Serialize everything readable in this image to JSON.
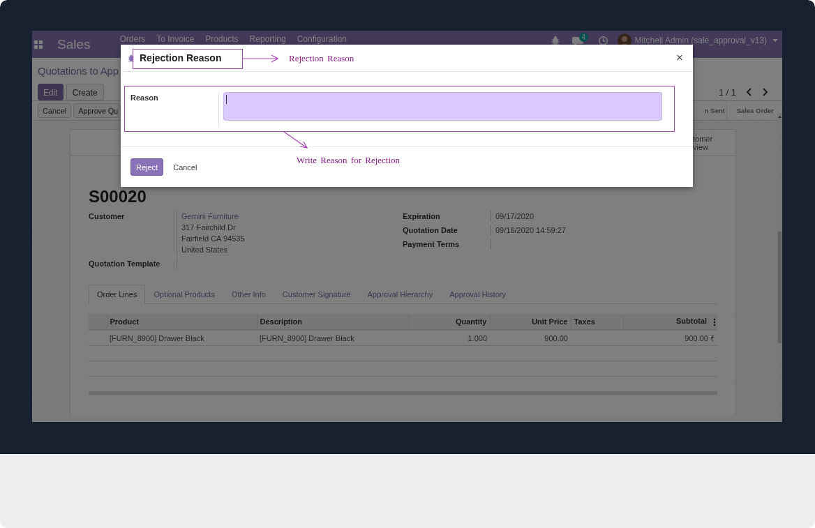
{
  "navbar": {
    "app_name": "Sales",
    "menu": [
      "Orders",
      "To Invoice",
      "Products",
      "Reporting",
      "Configuration"
    ],
    "message_count": "4",
    "user": "Mitchell Admin (sale_approval_v13)"
  },
  "breadcrumb": "Quotations to App",
  "actions": [
    "Edit",
    "Create"
  ],
  "pager": "1 / 1",
  "header_buttons": [
    "Cancel",
    "Approve Qu"
  ],
  "stages": [
    "n Sent",
    "Sales Order"
  ],
  "smart_button": {
    "lines": [
      "tomer",
      "view"
    ]
  },
  "record": {
    "name": "S00020",
    "left_fields": [
      {
        "label": "Customer",
        "link": "Gemini Furniture",
        "lines": [
          "317 Fairchild Dr",
          "Fairfield CA 94535",
          "United States"
        ]
      },
      {
        "label": "Quotation Template"
      }
    ],
    "right_fields": [
      {
        "label": "Expiration",
        "value": "09/17/2020"
      },
      {
        "label": "Quotation Date",
        "value": "09/16/2020 14:59:27"
      },
      {
        "label": "Payment Terms"
      }
    ]
  },
  "tabs": [
    {
      "label": "Order Lines",
      "selected": true
    },
    {
      "label": "Optional Products",
      "selected": false
    },
    {
      "label": "Other Info",
      "selected": false
    },
    {
      "label": "Customer Signature",
      "selected": false
    },
    {
      "label": "Approval Hierarchy",
      "selected": false
    },
    {
      "label": "Approval History",
      "selected": false
    }
  ],
  "table": {
    "columns": [
      {
        "label": "Product",
        "kind": "text"
      },
      {
        "label": "Description",
        "kind": "text"
      },
      {
        "label": "Quantity",
        "kind": "number"
      },
      {
        "label": "Unit Price",
        "kind": "number"
      },
      {
        "label": "Taxes",
        "kind": "text"
      },
      {
        "label": "Subtotal",
        "kind": "number"
      }
    ],
    "rows": [
      {
        "cells": [
          "[FURN_8900] Drawer Black",
          "[FURN_8900] Drawer Black",
          "1.000",
          "900.00",
          "",
          "900.00 ₹"
        ]
      }
    ]
  },
  "dialog": {
    "title": "Rejection Reason",
    "close": "×",
    "field_label": "Reason",
    "buttons": [
      {
        "label": "Reject",
        "kind": "primary"
      },
      {
        "label": "Cancel",
        "kind": "secondary"
      }
    ],
    "annotations": [
      {
        "text": "Rejection Reason"
      },
      {
        "text": "Write Reason for Rejection"
      }
    ]
  }
}
